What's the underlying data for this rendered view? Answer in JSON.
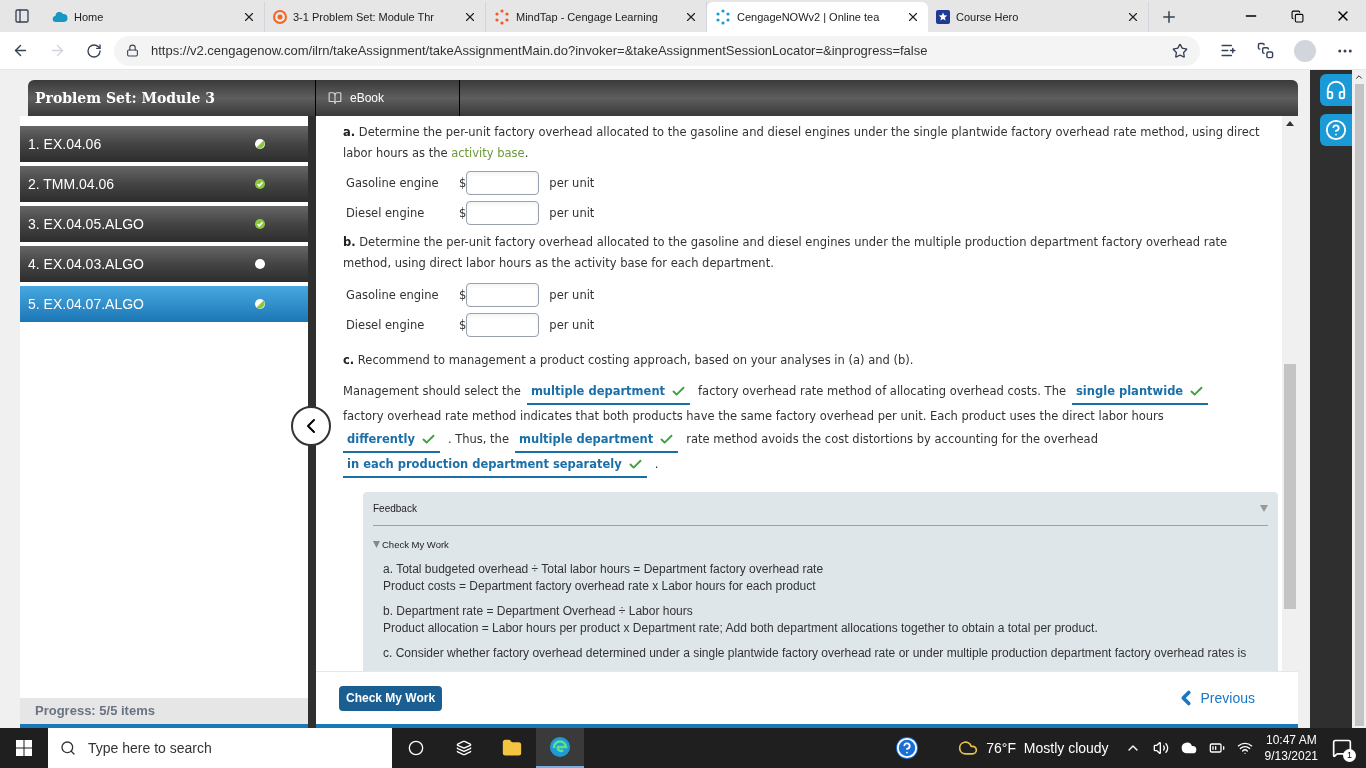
{
  "browser": {
    "tabs": [
      {
        "title": "Home",
        "selected": false
      },
      {
        "title": "3-1 Problem Set: Module Thr",
        "selected": false
      },
      {
        "title": "MindTap - Cengage Learning",
        "selected": false
      },
      {
        "title": "CengageNOWv2 | Online tea",
        "selected": true
      },
      {
        "title": "Course Hero",
        "selected": false
      }
    ],
    "url": "https://v2.cengagenow.com/ilrn/takeAssignment/takeAssignmentMain.do?invoker=&takeAssignmentSessionLocator=&inprogress=false"
  },
  "assignment": {
    "title": "Problem Set: Module 3",
    "ebook": "eBook",
    "progress": "Progress: 5/5 items"
  },
  "sidebar": {
    "items": [
      {
        "label": "1. EX.04.06",
        "answered": true,
        "correct": false,
        "selected": false
      },
      {
        "label": "2. TMM.04.06",
        "answered": true,
        "correct": true,
        "selected": false
      },
      {
        "label": "3. EX.04.05.ALGO",
        "answered": true,
        "correct": true,
        "selected": false
      },
      {
        "label": "4. EX.04.03.ALGO",
        "answered": false,
        "correct": false,
        "selected": false
      },
      {
        "label": "5. EX.04.07.ALGO",
        "answered": true,
        "correct": false,
        "selected": true
      }
    ]
  },
  "question_a": {
    "label": "a.",
    "text": "Determine the per-unit factory overhead allocated to the gasoline and diesel engines under the single plantwide factory overhead rate method, using direct labor hours as the ",
    "link": "activity base",
    "end": ".",
    "rows": [
      {
        "label": "Gasoline engine",
        "currency": "$",
        "unit": "per unit"
      },
      {
        "label": "Diesel engine",
        "currency": "$",
        "unit": "per unit"
      }
    ]
  },
  "question_b": {
    "label": "b.",
    "text": "Determine the per-unit factory overhead allocated to the gasoline and diesel engines under the multiple production department factory overhead rate method, using direct labor hours as the activity base for each department.",
    "rows": [
      {
        "label": "Gasoline engine",
        "currency": "$",
        "unit": "per unit"
      },
      {
        "label": "Diesel engine",
        "currency": "$",
        "unit": "per unit"
      }
    ]
  },
  "question_c": {
    "label": "c.",
    "text": "Recommend to management a product costing approach, based on your analyses in (a) and (b).",
    "segments": [
      {
        "kind": "text",
        "text": "Management should select the"
      },
      {
        "kind": "answer",
        "text": "multiple department",
        "correct": true
      },
      {
        "kind": "text",
        "text": "factory overhead rate method of allocating overhead costs. The"
      },
      {
        "kind": "answer",
        "text": "single plantwide",
        "correct": true
      },
      {
        "kind": "text",
        "text": "factory overhead rate method indicates that both products have the same factory overhead per unit. Each product uses the direct labor hours"
      },
      {
        "kind": "answer",
        "text": "differently",
        "correct": true
      },
      {
        "kind": "text",
        "text": ". Thus, the"
      },
      {
        "kind": "answer",
        "text": "multiple department",
        "correct": true
      },
      {
        "kind": "text",
        "text": "rate method avoids the cost distortions by accounting for the overhead"
      },
      {
        "kind": "answer",
        "text": "in each production department separately",
        "correct": true
      },
      {
        "kind": "text",
        "text": "."
      }
    ]
  },
  "feedback": {
    "title": "Feedback",
    "section": "Check My Work",
    "expanded": true,
    "paragraphs": [
      [
        "a. Total budgeted overhead ÷ Total labor hours = Department factory overhead rate",
        "Product costs = Department factory overhead rate x Labor hours for each product"
      ],
      [
        "b. Department rate = Department Overhead ÷ Labor hours",
        "Product allocation = Labor hours per product x Department rate; Add both department allocations together to obtain a total per product."
      ],
      [
        "c. Consider whether factory overhead determined under a single plantwide factory overhead rate or under multiple production department factory overhead rates is"
      ]
    ]
  },
  "footer": {
    "check_button": "Check My Work",
    "previous": "Previous"
  },
  "taskbar": {
    "search_placeholder": "Type here to search",
    "weather": "76°F  Mostly cloudy",
    "time": "10:47 AM",
    "date": "9/13/2021",
    "notifications": "1"
  }
}
